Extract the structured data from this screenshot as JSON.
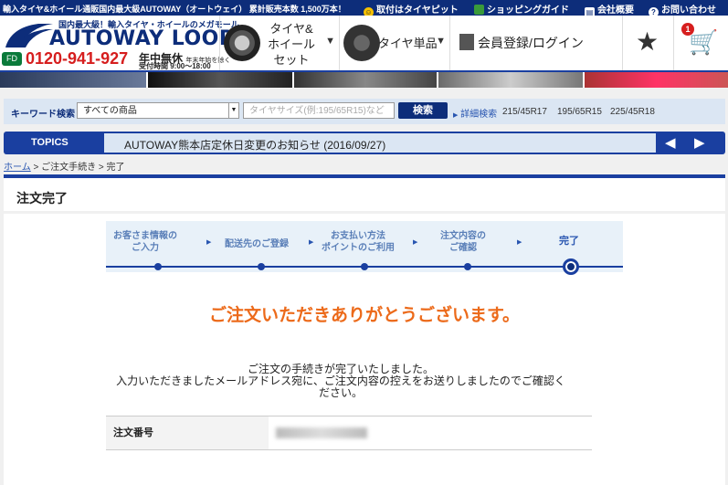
{
  "topbar": {
    "message": "輸入タイヤ&ホイール通販国内最大級AUTOWAY（オートウェイ） 累計販売本数 1,500万本！",
    "links": [
      "取付はタイヤピット",
      "ショッピングガイド",
      "会社概要",
      "お問い合わせ"
    ]
  },
  "header": {
    "logo_sub": "国内最大級！輸入タイヤ・ホイールのメガモール",
    "logo_main": "AUTOWAY LOOP",
    "phone_icon": "FD",
    "phone": "0120-941-927",
    "phone_note1": "年中無休",
    "phone_note1_small": "年末年始を除く",
    "phone_note2": "受付時間 9:00～18:00",
    "nav": {
      "tire_wheel_set": "タイヤ&\nホイール\nセット",
      "tire_single": "タイヤ単品",
      "member": "会員登録/ログイン"
    },
    "cart_count": "1"
  },
  "search": {
    "label": "キーワード検索",
    "category_value": "すべての商品",
    "placeholder": "タイヤサイズ(例:195/65R15)など",
    "button": "検索",
    "advanced": "詳細検索",
    "quick_sizes": [
      "215/45R17",
      "195/65R15",
      "225/45R18"
    ]
  },
  "topics": {
    "label": "TOPICS",
    "text": "AUTOWAY熊本店定休日変更のお知らせ (2016/09/27)"
  },
  "breadcrumb": {
    "home": "ホーム",
    "items": [
      " > ご注文手続き > 完了"
    ]
  },
  "page": {
    "title": "注文完了",
    "steps": [
      "お客さま情報の\nご入力",
      "配送先のご登録",
      "お支払い方法\nポイントのご利用",
      "注文内容の\nご確認",
      "完了"
    ],
    "active_step": 4,
    "thanks": "ご注文いただきありがとうございます。",
    "done_line1": "ご注文の手続きが完了いたしました。",
    "done_line2": "入力いただきましたメールアドレス宛に、ご注文内容の控えをお送りしましたのでご確認く",
    "done_line3": "ださい。",
    "order_label": "注文番号"
  },
  "colors": {
    "navy": "#0d2d7a",
    "blue": "#1a3fa0",
    "orange": "#ec6a1a",
    "red": "#d61e1e"
  }
}
